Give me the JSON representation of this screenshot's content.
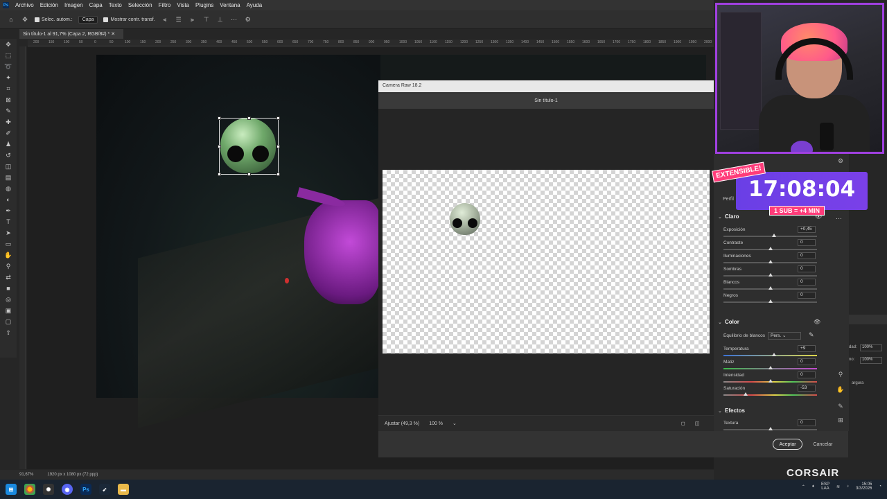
{
  "menubar": {
    "items": [
      "Archivo",
      "Edición",
      "Imagen",
      "Capa",
      "Texto",
      "Selección",
      "Filtro",
      "Vista",
      "Plugins",
      "Ventana",
      "Ayuda"
    ]
  },
  "options": {
    "auto_select_label": "Selec. autom.:",
    "auto_select_value": "Capa",
    "show_transform_label": "Mostrar contr. transf."
  },
  "document": {
    "tab_title": "Sin título-1 al 91,7% (Capa 2, RGB/8#) *",
    "zoom_status": "91,67%",
    "size_status": "1920 px x 1080 px (72 ppp)"
  },
  "ruler_ticks": [
    "200",
    "150",
    "100",
    "50",
    "0",
    "50",
    "100",
    "150",
    "200",
    "250",
    "300",
    "350",
    "400",
    "450",
    "500",
    "550",
    "600",
    "650",
    "700",
    "750",
    "800",
    "850",
    "900",
    "950",
    "1000",
    "1050",
    "1100",
    "1150",
    "1200",
    "1250",
    "1300",
    "1350",
    "1400",
    "1450",
    "1500",
    "1550",
    "1600",
    "1650",
    "1700",
    "1750",
    "1800",
    "1850",
    "1900",
    "1950",
    "2000"
  ],
  "camera_raw": {
    "window_title": "Camera Raw 18.2",
    "doc_title": "Sin título-1",
    "fit_label": "Ajustar (49,3 %)",
    "zoom_label": "100 %",
    "accept": "Aceptar",
    "cancel": "Cancelar",
    "profile_label": "Perfil",
    "sections": {
      "light": "Claro",
      "color": "Color",
      "effects": "Efectos"
    },
    "light_sliders": [
      {
        "label": "Exposición",
        "value": "+0,45",
        "pos": 0.54
      },
      {
        "label": "Contraste",
        "value": "0",
        "pos": 0.5
      },
      {
        "label": "Iluminaciones",
        "value": "0",
        "pos": 0.5
      },
      {
        "label": "Sombras",
        "value": "0",
        "pos": 0.5
      },
      {
        "label": "Blancos",
        "value": "0",
        "pos": 0.5
      },
      {
        "label": "Negros",
        "value": "0",
        "pos": 0.5
      }
    ],
    "white_balance_label": "Equilibrio de blancos",
    "white_balance_value": "Pers.",
    "color_sliders": [
      {
        "label": "Temperatura",
        "value": "+9",
        "pos": 0.54
      },
      {
        "label": "Matiz",
        "value": "0",
        "pos": 0.5
      },
      {
        "label": "Intensidad",
        "value": "0",
        "pos": 0.5
      },
      {
        "label": "Saturación",
        "value": "-53",
        "pos": 0.24
      }
    ],
    "effect_sliders": [
      {
        "label": "Textura",
        "value": "0",
        "pos": 0.5
      }
    ]
  },
  "overlay": {
    "timer": "17:08:04",
    "extensible": "EXTENSIBLE!",
    "sub_rule": "1 SUB = +4 MIN",
    "brand": "CORSAIR"
  },
  "side_panel": {
    "pct1": "100%",
    "pct2": "100%",
    "lbl1": "dad:",
    "lbl2": "no:",
    "lbl3": "argura"
  },
  "taskbar": {
    "lang": "ESP",
    "region": "LAA",
    "time": "15:05",
    "date": "3/3/2026"
  }
}
